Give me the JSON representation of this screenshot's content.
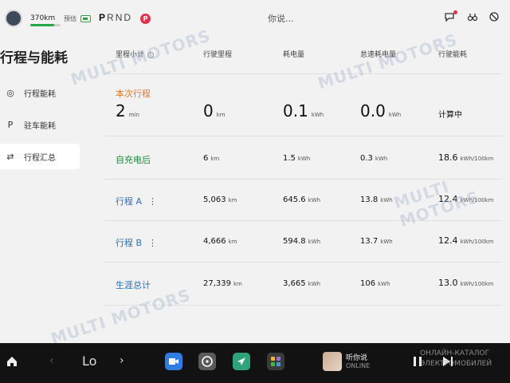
{
  "status_bar": {
    "range": "370km",
    "range_fraction": 0.8,
    "estimate_label": "预估",
    "gears": [
      "P",
      "R",
      "N",
      "D"
    ],
    "active_gear": "P",
    "p_badge": "P",
    "voice_prompt": "你说...",
    "icons": [
      "car-avatar",
      "battery-icon",
      "message-icon",
      "binoculars-icon",
      "no-signal-icon"
    ]
  },
  "page_title": "行程与能耗",
  "sidebar": {
    "items": [
      {
        "label": "行程能耗",
        "icon": "steering-wheel-icon",
        "glyph": "◎",
        "active": false
      },
      {
        "label": "驻车能耗",
        "icon": "parking-icon",
        "glyph": "P",
        "active": false
      },
      {
        "label": "行程汇总",
        "icon": "swap-icon",
        "glyph": "⇄",
        "active": true
      }
    ]
  },
  "table": {
    "headers": {
      "subtotal": "里程小计",
      "mileage": "行驶里程",
      "consumption": "耗电量",
      "idle": "怠速耗电量",
      "efficiency": "行驶能耗"
    },
    "current_trip": {
      "label": "本次行程",
      "duration": "2",
      "duration_unit": "min",
      "mileage": "0",
      "mileage_unit": "km",
      "consumption": "0.1",
      "consumption_unit": "kWh",
      "idle": "0.0",
      "idle_unit": "kWh",
      "efficiency": "计算中"
    },
    "rows": [
      {
        "label": "自充电后",
        "mileage": "6",
        "mileage_unit": "km",
        "consumption": "1.5",
        "consumption_unit": "kWh",
        "idle": "0.3",
        "idle_unit": "kWh",
        "efficiency": "18.6",
        "efficiency_unit": "kWh/100km"
      },
      {
        "label": "行程 A",
        "mileage": "5,063",
        "mileage_unit": "km",
        "consumption": "645.6",
        "consumption_unit": "kWh",
        "idle": "13.8",
        "idle_unit": "kWh",
        "efficiency": "12.4",
        "efficiency_unit": "kWh/100km"
      },
      {
        "label": "行程 B",
        "mileage": "4,666",
        "mileage_unit": "km",
        "consumption": "594.8",
        "consumption_unit": "kWh",
        "idle": "13.7",
        "idle_unit": "kWh",
        "efficiency": "12.4",
        "efficiency_unit": "kWh/100km"
      },
      {
        "label": "生涯总计",
        "mileage": "27,339",
        "mileage_unit": "km",
        "consumption": "3,665",
        "consumption_unit": "kWh",
        "idle": "106",
        "idle_unit": "kWh",
        "efficiency": "13.0",
        "efficiency_unit": "kWh/100km"
      }
    ]
  },
  "dock": {
    "home_icon": "home-icon",
    "temperature": "Lo",
    "apps": [
      "video-call-app-icon",
      "steering-app-icon",
      "navigation-app-icon",
      "app-grid-icon"
    ],
    "media_title": "听你说",
    "media_subtitle": "ONLINE",
    "media_controls": [
      "pause-icon",
      "next-track-icon"
    ]
  },
  "watermarks": {
    "brand": "MULTI MOTORS",
    "tagline_1": "ОНЛАЙН-КАТАЛОГ",
    "tagline_2": "ЭЛЕКТРОМОБИЛЕЙ"
  },
  "colors": {
    "accent_orange": "#e07b2d",
    "accent_green": "#1a8a3a",
    "accent_blue": "#2a6fb5",
    "badge_red": "#e0334c",
    "range_green": "#28a745"
  }
}
